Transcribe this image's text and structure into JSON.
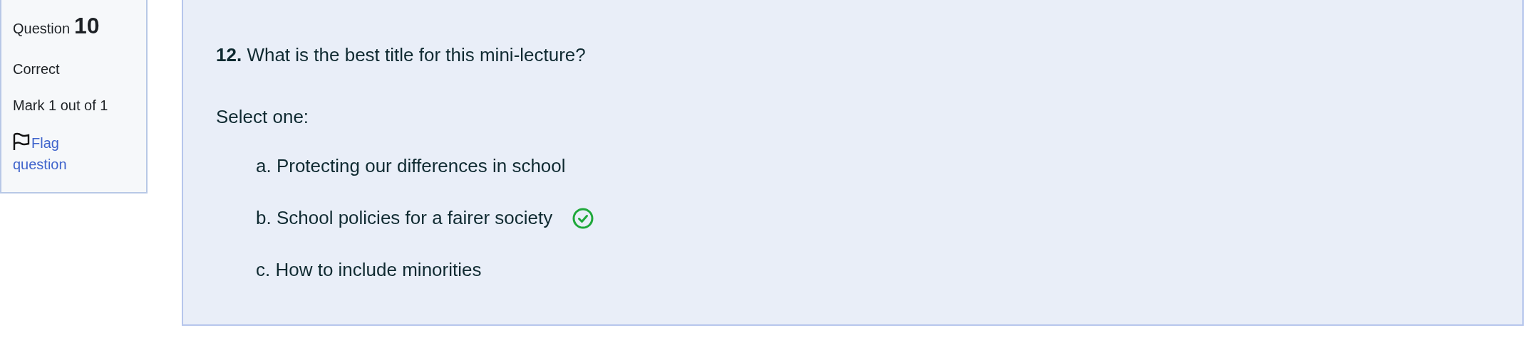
{
  "info": {
    "label": "Question",
    "number": "10",
    "status": "Correct",
    "mark": "Mark 1 out of 1",
    "flag": {
      "label": "Flag question",
      "flagged": false
    }
  },
  "question": {
    "number": "12.",
    "text": "What is the best title for this mini-lecture?",
    "prompt": "Select one:",
    "options": [
      {
        "label": "a. Protecting our differences in school",
        "marked_correct": false
      },
      {
        "label": "b. School policies for a fairer society",
        "marked_correct": true
      },
      {
        "label": "c. How to include minorities",
        "marked_correct": false
      }
    ]
  }
}
